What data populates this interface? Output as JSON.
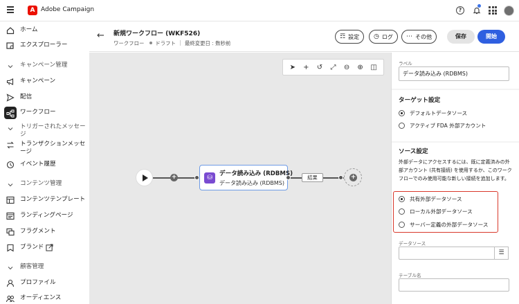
{
  "app": {
    "title": "Adobe Campaign",
    "logo_letter": "A",
    "help_glyph": "?"
  },
  "sidebar": {
    "items": [
      {
        "label": "ホーム",
        "icon": "home-icon"
      },
      {
        "label": "エクスプローラー",
        "icon": "explorer-icon"
      },
      {
        "label": "キャンペーン管理",
        "icon": "chevron-down-icon",
        "section": true
      },
      {
        "label": "キャンペーン",
        "icon": "megaphone-icon"
      },
      {
        "label": "配信",
        "icon": "send-icon"
      },
      {
        "label": "ワークフロー",
        "icon": "workflow-icon",
        "active": true
      },
      {
        "label": "トリガーされたメッセージ",
        "icon": "chevron-down-icon",
        "section": true
      },
      {
        "label": "トランザクションメッセージ",
        "icon": "transaction-icon"
      },
      {
        "label": "イベント履歴",
        "icon": "history-icon"
      },
      {
        "label": "コンテンツ管理",
        "icon": "chevron-down-icon",
        "section": true
      },
      {
        "label": "コンテンツテンプレート",
        "icon": "template-icon"
      },
      {
        "label": "ランディングページ",
        "icon": "landing-page-icon"
      },
      {
        "label": "フラグメント",
        "icon": "fragment-icon"
      },
      {
        "label": "ブランド",
        "icon": "brand-icon"
      },
      {
        "label": "顧客管理",
        "icon": "chevron-down-icon",
        "section": true
      },
      {
        "label": "プロファイル",
        "icon": "profile-icon"
      },
      {
        "label": "オーディエンス",
        "icon": "audience-icon"
      }
    ]
  },
  "header": {
    "title": "新規ワークフロー (WKF526)",
    "type": "ワークフロー",
    "status": "ドラフト",
    "modified": "最終変更日 : 数秒前",
    "settings_label": "設定",
    "logs_label": "ログ",
    "more_label": "その他",
    "save_label": "保存",
    "start_label": "開始"
  },
  "canvas": {
    "activity_title": "データ読み込み (RDBMS)",
    "activity_subtitle": "データ読み込み (RDBMS)",
    "output_label": "結果"
  },
  "panel": {
    "label_caption": "ラベル",
    "label_value": "データ読み込み (RDBMS)",
    "target_heading": "ターゲット設定",
    "target_options": [
      "デフォルトデータソース",
      "アクティブ FDA 外部アカウント"
    ],
    "target_selected": 0,
    "source_heading": "ソース設定",
    "source_description": "外部データにアクセスするには、既に定義済みの外部アカウント (共有接続) を使用するか、このワークフローでのみ使用可能な新しい接続を追加します。",
    "source_options": [
      "共有外部データソース",
      "ローカル外部データソース",
      "サーバー定義の外部データソース"
    ],
    "source_selected": 0,
    "datasource_caption": "データソース",
    "table_caption": "テーブル名"
  },
  "colors": {
    "primary": "#2f5fe0",
    "highlight": "#d9382a",
    "activity_icon": "#7a4bd1"
  }
}
